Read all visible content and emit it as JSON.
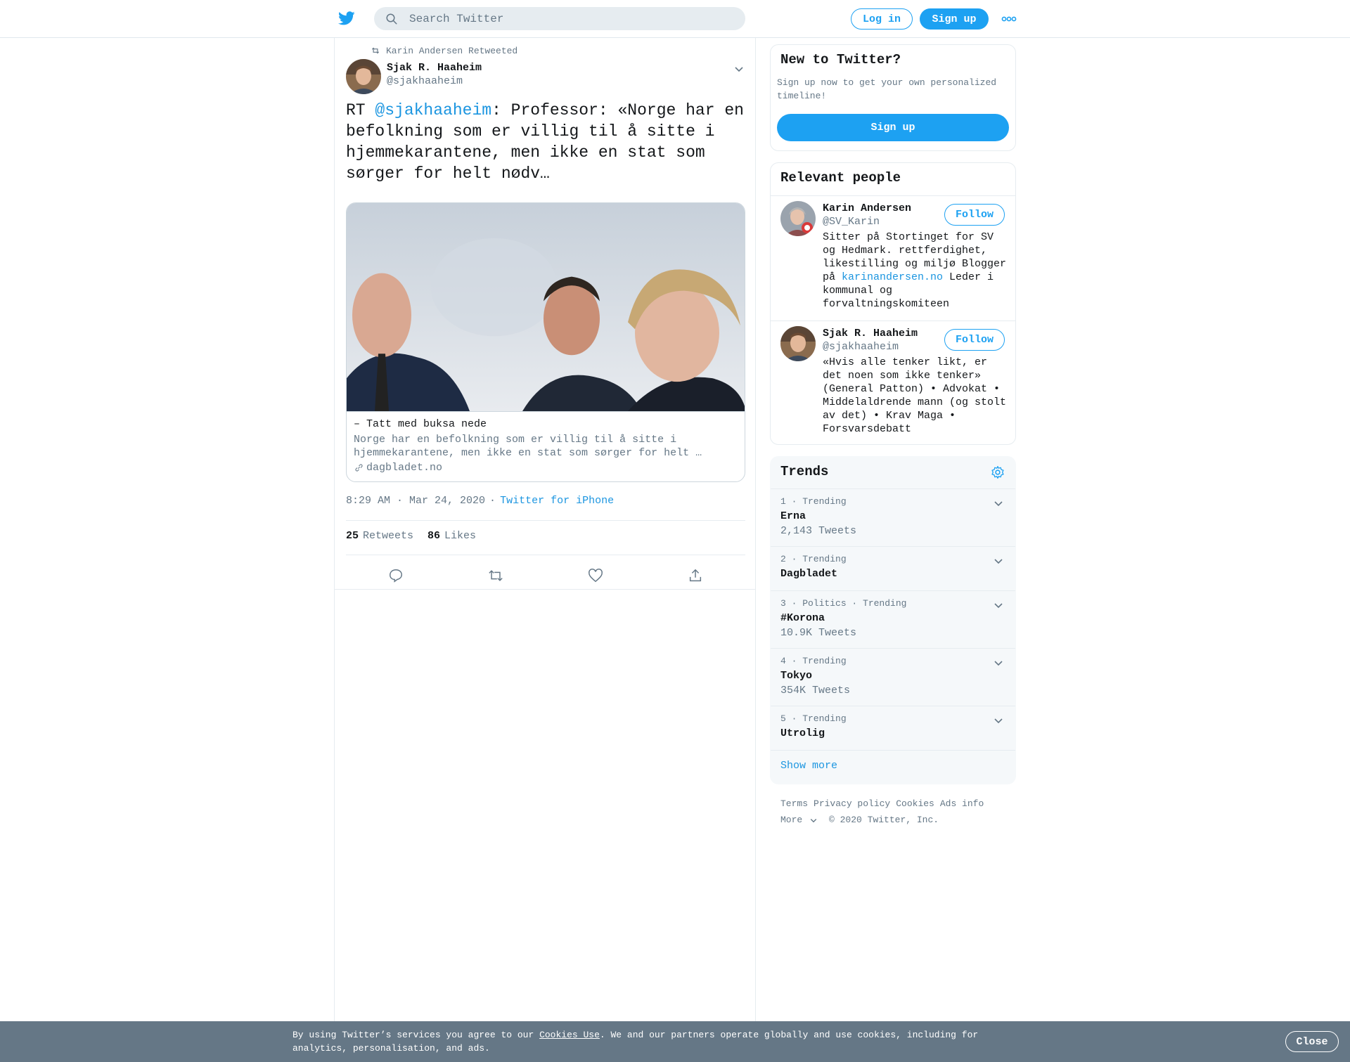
{
  "header": {
    "search_placeholder": "Search Twitter",
    "login_label": "Log in",
    "signup_label": "Sign up"
  },
  "tweet": {
    "retweeted_by": "Karin Andersen Retweeted",
    "author_name": "Sjak R. Haaheim",
    "author_handle": "@sjakhaaheim",
    "text_prefix": "RT ",
    "mention": "@sjakhaaheim",
    "text_body": ": Professor: «Norge har en befolkning som er villig til å sitte i hjemmekarantene, men ikke en stat som sørger for helt nødv…",
    "card": {
      "title": "– Tatt med buksa nede",
      "description": "Norge har en befolkning som er villig til å sitte i hjemmekarantene, men ikke en stat som sørger for helt …",
      "domain": "dagbladet.no"
    },
    "time": "8:29 AM · Mar 24, 2020",
    "separator": "·",
    "source": "Twitter for iPhone",
    "retweets_count": "25",
    "retweets_label": "Retweets",
    "likes_count": "86",
    "likes_label": "Likes"
  },
  "new_to_twitter": {
    "title": "New to Twitter?",
    "text": "Sign up now to get your own personalized timeline!",
    "button": "Sign up"
  },
  "relevant_people": {
    "title": "Relevant people",
    "people": [
      {
        "name": "Karin Andersen",
        "handle": "@SV_Karin",
        "follow": "Follow",
        "bio_before": "Sitter på Stortinget for SV og Hedmark. rettferdighet, likestilling og miljø Blogger på ",
        "bio_link": "karinandersen.no",
        "bio_after": " Leder i kommunal og forvaltningskomiteen"
      },
      {
        "name": "Sjak R. Haaheim",
        "handle": "@sjakhaaheim",
        "follow": "Follow",
        "bio": "«Hvis alle tenker likt, er det noen som ikke tenker» (General Patton) • Advokat • Middelaldrende mann (og stolt av det) • Krav Maga • Forsvarsdebatt"
      }
    ]
  },
  "trends": {
    "title": "Trends",
    "items": [
      {
        "meta": "1 · Trending",
        "name": "Erna",
        "count": "2,143 Tweets"
      },
      {
        "meta": "2 · Trending",
        "name": "Dagbladet",
        "count": ""
      },
      {
        "meta": "3 · Politics · Trending",
        "name": "#Korona",
        "count": "10.9K Tweets"
      },
      {
        "meta": "4 · Trending",
        "name": "Tokyo",
        "count": "354K Tweets"
      },
      {
        "meta": "5 · Trending",
        "name": "Utrolig",
        "count": ""
      }
    ],
    "show_more": "Show more"
  },
  "footer": {
    "links": [
      "Terms",
      "Privacy policy",
      "Cookies",
      "Ads info"
    ],
    "more": "More",
    "copyright": "© 2020 Twitter, Inc."
  },
  "cookie_bar": {
    "text_before": "By using Twitter’s services you agree to our ",
    "link": "Cookies Use",
    "text_after": ". We and our partners operate globally and use cookies, including for analytics, personalisation, and ads.",
    "close": "Close"
  },
  "colors": {
    "accent": "#1da1f2",
    "link": "#1b95e0",
    "muted": "#657786",
    "cookie_bar": "#657786"
  },
  "icons": [
    "twitter-bird-icon",
    "search-icon",
    "more-dots-icon",
    "retweet-icon",
    "chevron-down-icon",
    "link-icon",
    "reply-icon",
    "like-icon",
    "share-icon",
    "gear-icon"
  ]
}
